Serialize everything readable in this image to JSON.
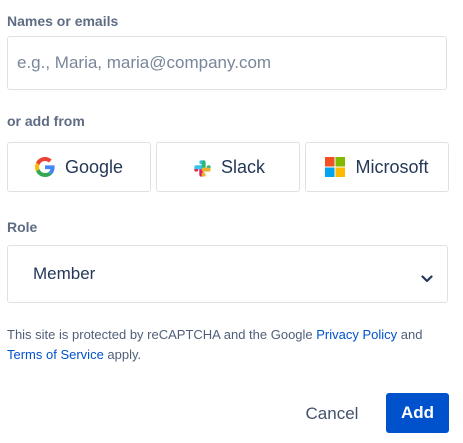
{
  "form": {
    "names_label": "Names or emails",
    "names_placeholder": "e.g., Maria, maria@company.com",
    "names_value": "",
    "add_from_label": "or add from",
    "providers": [
      {
        "label": "Google",
        "icon": "google-icon"
      },
      {
        "label": "Slack",
        "icon": "slack-icon"
      },
      {
        "label": "Microsoft",
        "icon": "microsoft-icon"
      }
    ],
    "role_label": "Role",
    "role_value": "Member"
  },
  "legal": {
    "text_start": "This site is protected by reCAPTCHA and the Google ",
    "privacy_link": "Privacy Policy",
    "text_mid": " and ",
    "terms_link": "Terms of Service",
    "text_end": " apply."
  },
  "actions": {
    "cancel_label": "Cancel",
    "add_label": "Add"
  },
  "colors": {
    "primary": "#0052cc",
    "link": "#0052cc",
    "border": "#dfe1e6"
  }
}
